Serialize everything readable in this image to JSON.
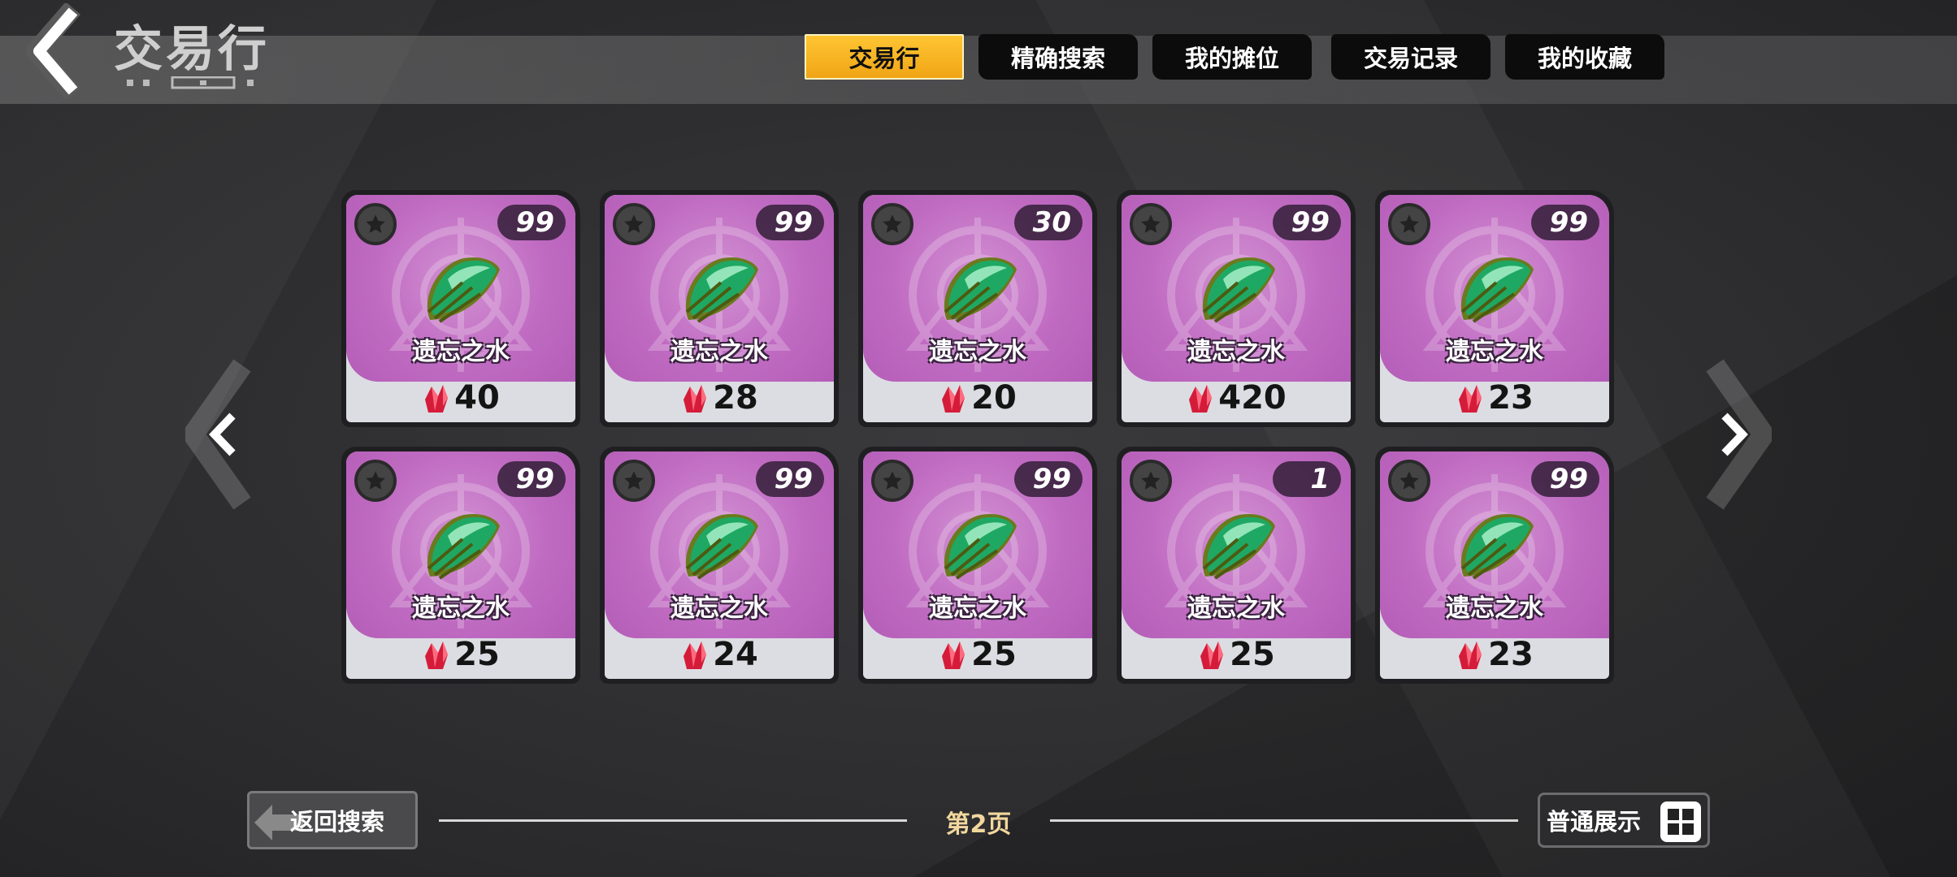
{
  "header": {
    "title": "交易行",
    "tabs": [
      {
        "label": "交易行",
        "active": true
      },
      {
        "label": "精确搜索",
        "active": false
      },
      {
        "label": "我的摊位",
        "active": false
      },
      {
        "label": "交易记录",
        "active": false
      },
      {
        "label": "我的收藏",
        "active": false
      }
    ]
  },
  "items": [
    {
      "name": "遗忘之水",
      "count": "99",
      "price": "40"
    },
    {
      "name": "遗忘之水",
      "count": "99",
      "price": "28"
    },
    {
      "name": "遗忘之水",
      "count": "30",
      "price": "20"
    },
    {
      "name": "遗忘之水",
      "count": "99",
      "price": "420"
    },
    {
      "name": "遗忘之水",
      "count": "99",
      "price": "23"
    },
    {
      "name": "遗忘之水",
      "count": "99",
      "price": "25"
    },
    {
      "name": "遗忘之水",
      "count": "99",
      "price": "24"
    },
    {
      "name": "遗忘之水",
      "count": "99",
      "price": "25"
    },
    {
      "name": "遗忘之水",
      "count": "1",
      "price": "25"
    },
    {
      "name": "遗忘之水",
      "count": "99",
      "price": "23"
    }
  ],
  "footer": {
    "return_label": "返回搜索",
    "page_label": "第2页",
    "display_label": "普通展示"
  },
  "colors": {
    "tab_active": "#f5b21f",
    "card_purple": "#c06bc2",
    "price_bg": "#dcdde2",
    "page_label": "#f2d79e"
  },
  "icons": {
    "back": "chevron-left-icon",
    "prev": "chevron-left-icon",
    "next": "chevron-right-icon",
    "currency": "red-crystal-icon",
    "item": "green-gem-icon",
    "rarity": "star-icon",
    "display": "grid-view-icon"
  }
}
